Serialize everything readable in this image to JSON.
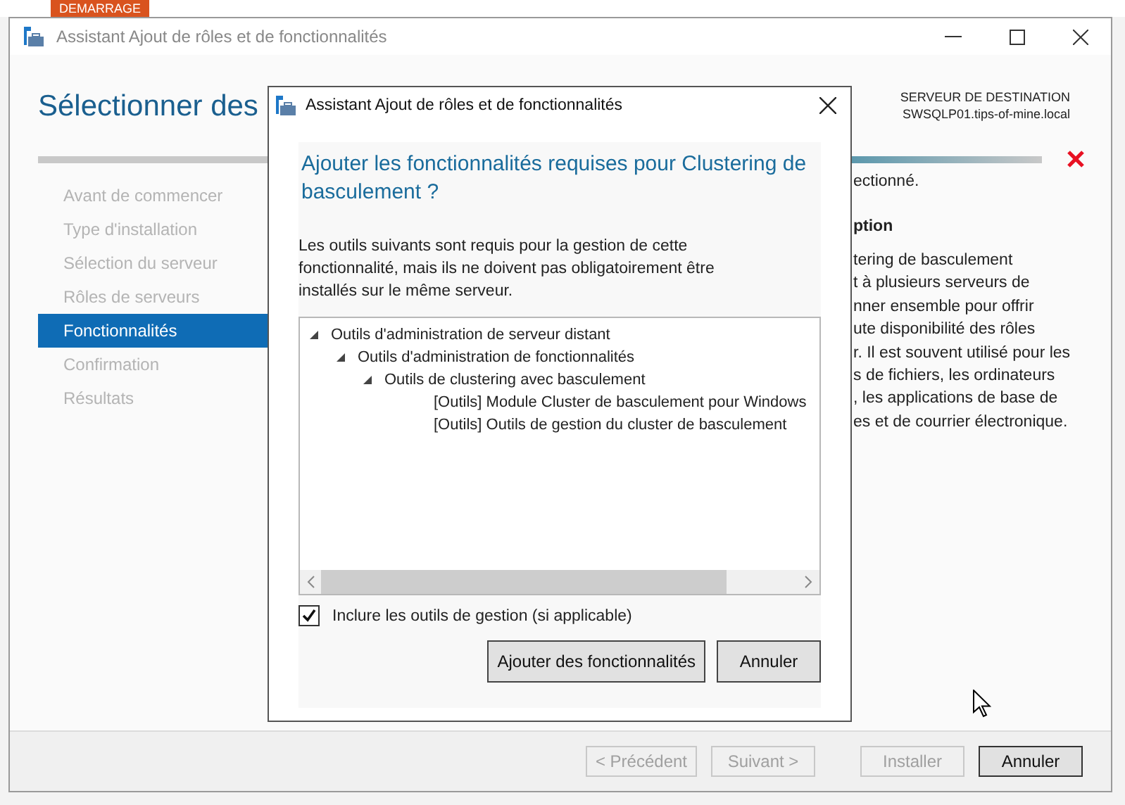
{
  "desktop_tab": {
    "label": "DEMARRAGE"
  },
  "window": {
    "title": "Assistant Ajout de rôles et de fonctionnalités"
  },
  "page_heading": "Sélectionner des",
  "destination": {
    "label": "SERVEUR DE DESTINATION",
    "server": "SWSQLP01.tips-of-mine.local"
  },
  "sidebar": {
    "items": [
      {
        "label": "Avant de commencer",
        "selected": false
      },
      {
        "label": "Type d'installation",
        "selected": false
      },
      {
        "label": "Sélection du serveur",
        "selected": false
      },
      {
        "label": "Rôles de serveurs",
        "selected": false
      },
      {
        "label": "Fonctionnalités",
        "selected": true
      },
      {
        "label": "Confirmation",
        "selected": false
      },
      {
        "label": "Résultats",
        "selected": false
      }
    ]
  },
  "right_panel": {
    "status_text": "ectionné.",
    "description_heading": "ption",
    "description_lines": [
      "tering de basculement",
      "t à plusieurs serveurs de",
      "nner ensemble pour offrir",
      "ute disponibilité des rôles",
      "r. Il est souvent utilisé pour les",
      "s de fichiers, les ordinateurs",
      ", les applications de base de",
      "es et de courrier électronique."
    ]
  },
  "footer_buttons": [
    {
      "label": "< Précédent",
      "disabled": true
    },
    {
      "label": "Suivant >",
      "disabled": true
    },
    {
      "label": "Installer",
      "disabled": true
    },
    {
      "label": "Annuler",
      "disabled": false
    }
  ],
  "dialog": {
    "title": "Assistant Ajout de rôles et de fonctionnalités",
    "heading": "Ajouter les fonctionnalités requises pour Clustering de basculement ?",
    "description": "Les outils suivants sont requis pour la gestion de cette fonctionnalité, mais ils ne doivent pas obligatoirement être installés sur le même serveur.",
    "tree": [
      {
        "label": "Outils d'administration de serveur distant",
        "expanded": true,
        "children": [
          {
            "label": "Outils d'administration de fonctionnalités",
            "expanded": true,
            "children": [
              {
                "label": "Outils de clustering avec basculement",
                "expanded": true,
                "children": [
                  {
                    "label": "[Outils] Module Cluster de basculement pour Windows"
                  },
                  {
                    "label": "[Outils] Outils de gestion du cluster de basculement"
                  }
                ]
              }
            ]
          }
        ]
      }
    ],
    "include_tools": {
      "label": "Inclure les outils de gestion (si applicable)",
      "checked": true
    },
    "buttons": [
      {
        "label": "Ajouter des fonctionnalités"
      },
      {
        "label": "Annuler"
      }
    ]
  }
}
